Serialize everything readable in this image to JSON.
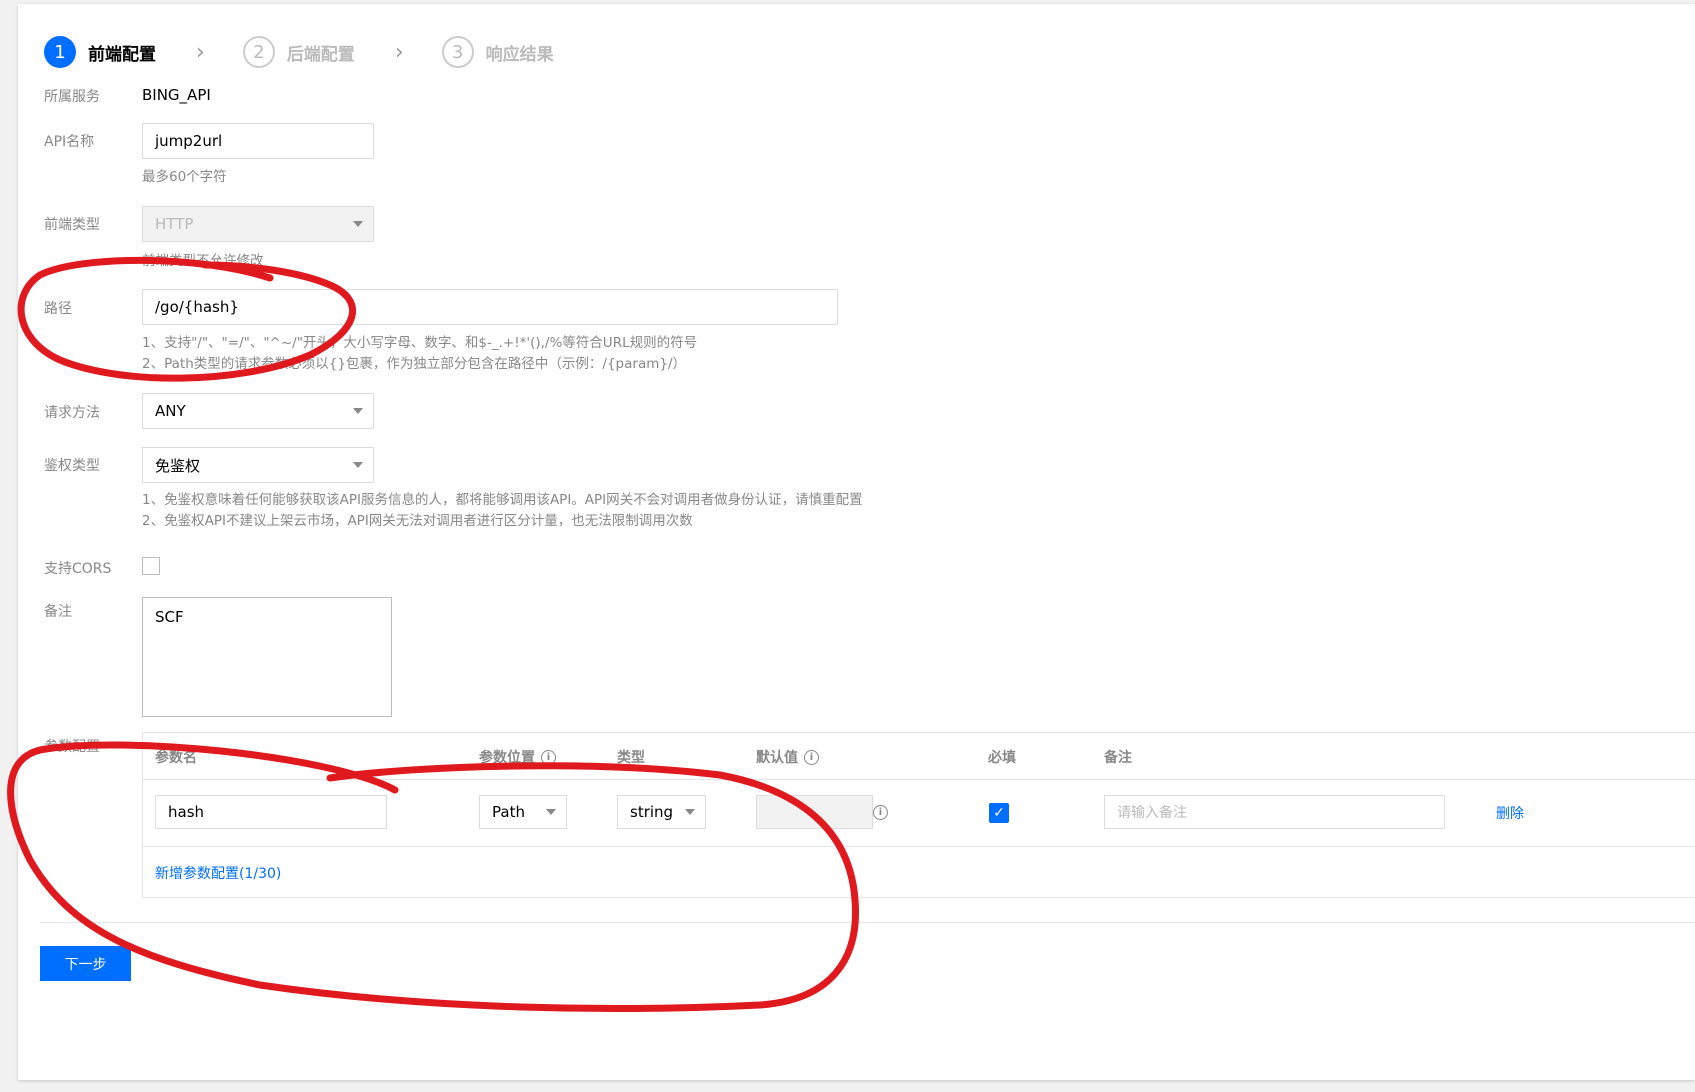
{
  "steps": [
    {
      "num": "1",
      "label": "前端配置"
    },
    {
      "num": "2",
      "label": "后端配置"
    },
    {
      "num": "3",
      "label": "响应结果"
    }
  ],
  "service": {
    "label": "所属服务",
    "value": "BING_API"
  },
  "api_name": {
    "label": "API名称",
    "value": "jump2url",
    "hint": "最多60个字符"
  },
  "frontend_type": {
    "label": "前端类型",
    "value": "HTTP",
    "hint": "前端类型不允许修改"
  },
  "path": {
    "label": "路径",
    "value": "/go/{hash}",
    "hint1": "1、支持\"/\"、\"=/\"、\"^~/\"开头，大小写字母、数字、和$-_.+!*'(),/%等符合URL规则的符号",
    "hint2": "2、Path类型的请求参数必须以{}包裹，作为独立部分包含在路径中（示例：/{param}/）"
  },
  "method": {
    "label": "请求方法",
    "value": "ANY"
  },
  "auth": {
    "label": "鉴权类型",
    "value": "免鉴权",
    "hint1": "1、免鉴权意味着任何能够获取该API服务信息的人，都将能够调用该API。API网关不会对调用者做身份认证，请慎重配置",
    "hint2": "2、免鉴权API不建议上架云市场，API网关无法对调用者进行区分计量，也无法限制调用次数"
  },
  "cors": {
    "label": "支持CORS"
  },
  "remark": {
    "label": "备注",
    "value": "SCF"
  },
  "params": {
    "label": "参数配置",
    "headers": {
      "name": "参数名",
      "position": "参数位置",
      "type": "类型",
      "default": "默认值",
      "required": "必填",
      "remark": "备注"
    },
    "rows": [
      {
        "name": "hash",
        "position": "Path",
        "type": "string",
        "default": "",
        "remark_placeholder": "请输入备注",
        "delete": "删除"
      }
    ],
    "add_link": "新增参数配置(1/30)"
  },
  "next_button": "下一步",
  "colors": {
    "primary": "#006eff",
    "annotation": "#e0191f"
  }
}
